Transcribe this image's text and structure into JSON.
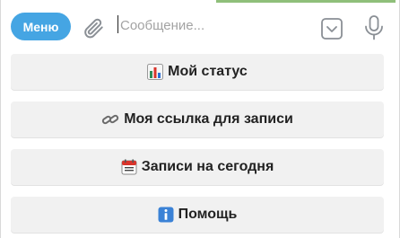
{
  "input_bar": {
    "menu_label": "Меню",
    "placeholder": "Сообщение..."
  },
  "keyboard": {
    "buttons": [
      {
        "emoji": "📊",
        "label": "Мой статус"
      },
      {
        "emoji": "🔗",
        "label": "Моя ссылка для записи"
      },
      {
        "emoji": "📅",
        "label": "Записи на сегодня"
      },
      {
        "emoji": "ℹ️",
        "label": "Помощь"
      }
    ]
  },
  "colors": {
    "menu_button": "#45a5e3",
    "key_background": "#f1f1f1",
    "icon": "#8a8f95"
  }
}
